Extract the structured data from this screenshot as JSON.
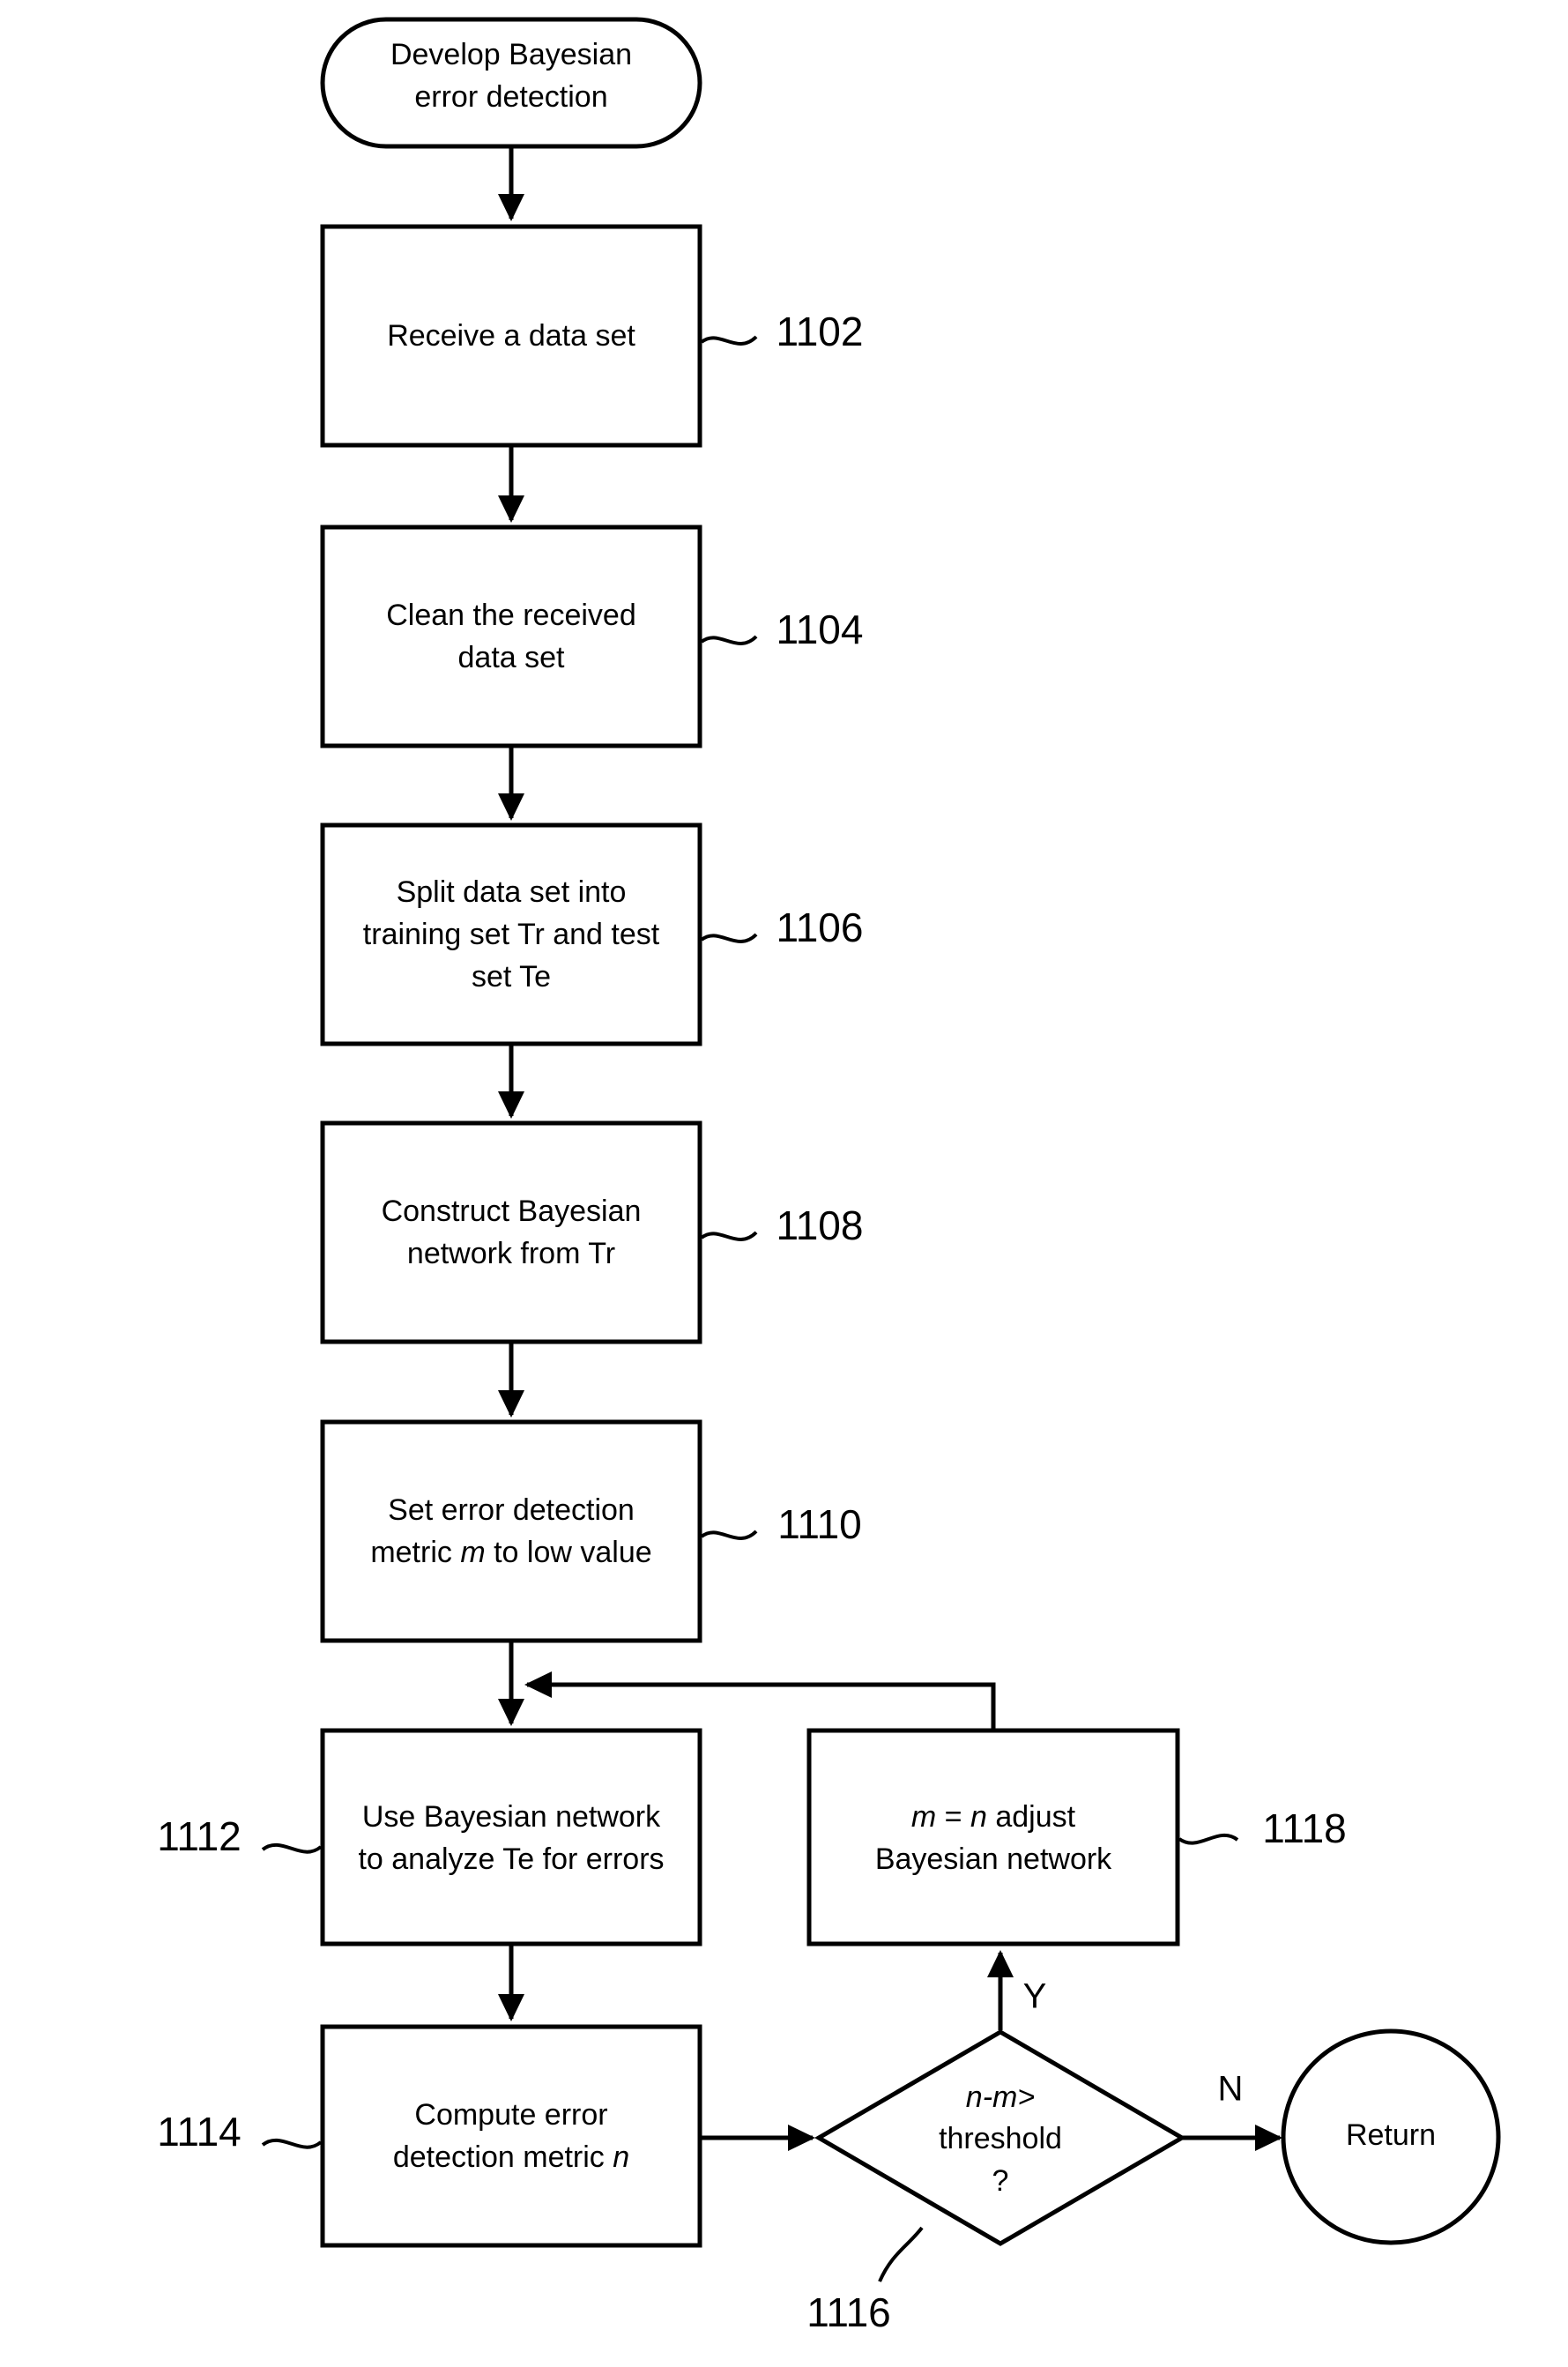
{
  "figure": {
    "type": "flowchart",
    "orientation": "vertical"
  },
  "start": {
    "label_line1": "Develop Bayesian",
    "label_line2": "error detection",
    "shape": "rounded-terminator"
  },
  "steps": [
    {
      "ref": "1102",
      "shape": "process",
      "lines": [
        "Receive a data set"
      ]
    },
    {
      "ref": "1104",
      "shape": "process",
      "lines": [
        "Clean the received",
        "data set"
      ]
    },
    {
      "ref": "1106",
      "shape": "process",
      "lines": [
        "Split data set into",
        "training set Tr and test",
        "set Te"
      ]
    },
    {
      "ref": "1108",
      "shape": "process",
      "lines": [
        "Construct Bayesian",
        "network from Tr"
      ]
    },
    {
      "ref": "1110",
      "shape": "process",
      "lines": [
        "Set error detection",
        "metric m to low value"
      ],
      "italic_tokens": [
        "m"
      ]
    },
    {
      "ref": "1112",
      "shape": "process",
      "lines": [
        "Use Bayesian network",
        "to analyze Te for errors"
      ]
    },
    {
      "ref": "1114",
      "shape": "process",
      "lines": [
        "Compute error",
        "detection metric n"
      ],
      "italic_tokens": [
        "n"
      ]
    },
    {
      "ref": "1116",
      "shape": "decision",
      "lines": [
        "n-m>",
        "threshold",
        "?"
      ],
      "italic_tokens": [
        "n-m>"
      ]
    },
    {
      "ref": "1118",
      "shape": "process",
      "lines": [
        "m = n adjust",
        "Bayesian network"
      ],
      "italic_tokens": [
        "m = n"
      ]
    }
  ],
  "text": {
    "s1102_l1": "Receive a data set",
    "s1104_l1": "Clean the received",
    "s1104_l2": "data set",
    "s1106_l1": "Split data set into",
    "s1106_l2": "training set Tr and test",
    "s1106_l3": "set Te",
    "s1108_l1": "Construct Bayesian",
    "s1108_l2": "network from Tr",
    "s1110_l1": "Set error detection",
    "s1110_l2a": "metric ",
    "s1110_l2b": "m",
    "s1110_l2c": " to low value",
    "s1112_l1": "Use Bayesian network",
    "s1112_l2": "to analyze Te for errors",
    "s1114_l1": "Compute error",
    "s1114_l2a": "detection metric ",
    "s1114_l2b": "n",
    "s1116_l1": "n-m>",
    "s1116_l2": "threshold",
    "s1116_l3": "?",
    "s1118_l1a": "m",
    "s1118_l1b": " = ",
    "s1118_l1c": "n",
    "s1118_l1d": " adjust",
    "s1118_l2": "Bayesian network",
    "start_l1": "Develop Bayesian",
    "start_l2": "error detection",
    "return_label": "Return"
  },
  "refs": {
    "r1102": "1102",
    "r1104": "1104",
    "r1106": "1106",
    "r1108": "1108",
    "r1110": "1110",
    "r1112": "1112",
    "r1114": "1114",
    "r1116": "1116",
    "r1118": "1118"
  },
  "branches": {
    "yes_label": "Y",
    "no_label": "N"
  },
  "terminator": {
    "label": "Return",
    "shape": "circle"
  },
  "colors": {
    "stroke": "#000000",
    "fill": "#ffffff",
    "text": "#000000"
  }
}
